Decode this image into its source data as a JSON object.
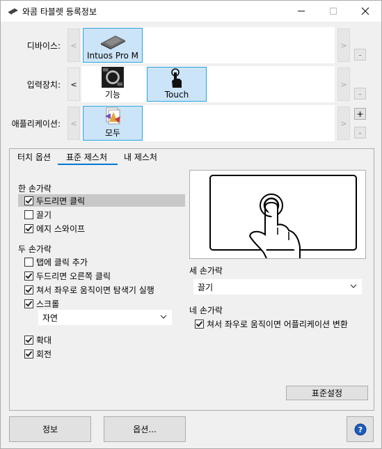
{
  "window": {
    "title": "와콤 타블렛 등록정보",
    "minimize_glyph": "—",
    "maximize_glyph": "☐",
    "close_glyph": "✕"
  },
  "rows": {
    "device": {
      "label": "디바이스:",
      "left_arrow": "<",
      "right_arrow": ">",
      "tiles": [
        {
          "label": "Intuos Pro M",
          "icon": "tablet-icon",
          "selected": true
        }
      ],
      "side_buttons": [
        "-"
      ]
    },
    "input_tool": {
      "label": "입력장치:",
      "left_arrow": "<",
      "right_arrow": ">",
      "tiles": [
        {
          "label": "기능",
          "icon": "expresskeys-icon",
          "selected": false
        },
        {
          "label": "Touch",
          "icon": "touch-hand-icon",
          "selected": true
        }
      ],
      "side_buttons": [
        "-"
      ]
    },
    "application": {
      "label": "애플리케이션:",
      "left_arrow": "<",
      "right_arrow": ">",
      "tiles": [
        {
          "label": "모두",
          "icon": "all-apps-icon",
          "selected": true
        }
      ],
      "side_buttons": [
        "+",
        "-"
      ]
    }
  },
  "tabs": [
    {
      "label": "터치 옵션",
      "active": false
    },
    {
      "label": "표준 제스처",
      "active": true
    },
    {
      "label": "내 제스처",
      "active": false
    }
  ],
  "one_finger": {
    "heading": "한 손가락",
    "options": [
      {
        "label": "두드리면 클릭",
        "checked": true,
        "highlighted": true
      },
      {
        "label": "끌기",
        "checked": false
      },
      {
        "label": "에지 스와이프",
        "checked": true
      }
    ]
  },
  "two_finger": {
    "heading": "두 손가락",
    "options": [
      {
        "label": "탭에 클릭 추가",
        "checked": false
      },
      {
        "label": "두드리면 오른쪽 클릭",
        "checked": true
      },
      {
        "label": "쳐서 좌우로 움직이면 탐색기 실행",
        "checked": true
      },
      {
        "label": "스크롤",
        "checked": true
      }
    ],
    "scroll_select": "자연",
    "options2": [
      {
        "label": "확대",
        "checked": true
      },
      {
        "label": "회전",
        "checked": true
      }
    ]
  },
  "three_finger": {
    "heading": "세 손가락",
    "select": "끌기"
  },
  "four_finger": {
    "heading": "네 손가락",
    "options": [
      {
        "label": "쳐서 좌우로 움직이면 어플리케이션 변환",
        "checked": true
      }
    ]
  },
  "buttons": {
    "defaults": "표준설정",
    "about": "정보",
    "options": "옵션...",
    "help_glyph": "?"
  },
  "colors": {
    "selection_bg": "#cce4f7",
    "selection_border": "#26a0da",
    "tab_accent": "#0078d7",
    "help_blue": "#1e5bb8"
  }
}
